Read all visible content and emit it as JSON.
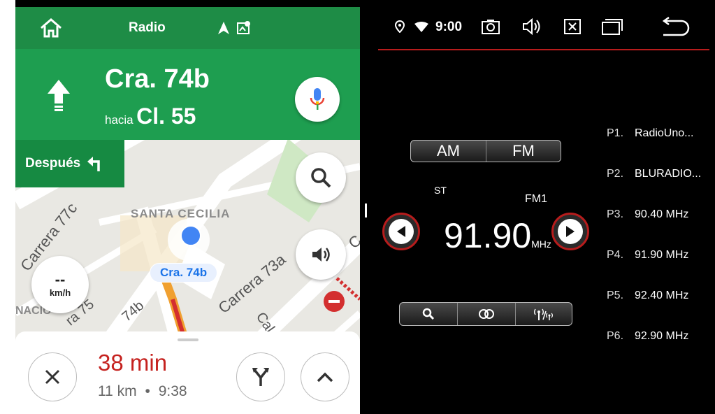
{
  "app_bar": {
    "title": "Radio"
  },
  "nav": {
    "street": "Cra. 74b",
    "toward_prefix": "hacia",
    "toward_street": "Cl. 55",
    "after_label": "Después"
  },
  "map": {
    "labels": {
      "carrera77c": "Carrera 77c",
      "santa_cecilia": "SANTA CECILIA",
      "carrera73a": "Carrera 73a",
      "carrera75": "ra 75",
      "c74b": "74b",
      "nacio": "NACIO",
      "cal": "Cal",
      "c_short": "C",
      "current_street": "Cra. 74b"
    }
  },
  "speed": {
    "value": "--",
    "unit": "km/h"
  },
  "trip": {
    "duration": "38 min",
    "distance": "11 km",
    "separator": "•",
    "eta": "9:38"
  },
  "status_bar": {
    "time": "9:00"
  },
  "radio": {
    "band_am": "AM",
    "band_fm": "FM",
    "stereo": "ST",
    "band_slot": "FM1",
    "frequency": "91.90",
    "unit": "MHz",
    "presets": [
      {
        "num": "P1.",
        "label": "RadioUno..."
      },
      {
        "num": "P2.",
        "label": "BLURADIO..."
      },
      {
        "num": "P3.",
        "label": "90.40 MHz"
      },
      {
        "num": "P4.",
        "label": "91.90 MHz"
      },
      {
        "num": "P5.",
        "label": "92.40 MHz"
      },
      {
        "num": "P6.",
        "label": "92.90 MHz"
      }
    ]
  },
  "colors": {
    "nav_green": "#1e9e50",
    "accent_red": "#c0392b",
    "route": "#d32f2f"
  }
}
